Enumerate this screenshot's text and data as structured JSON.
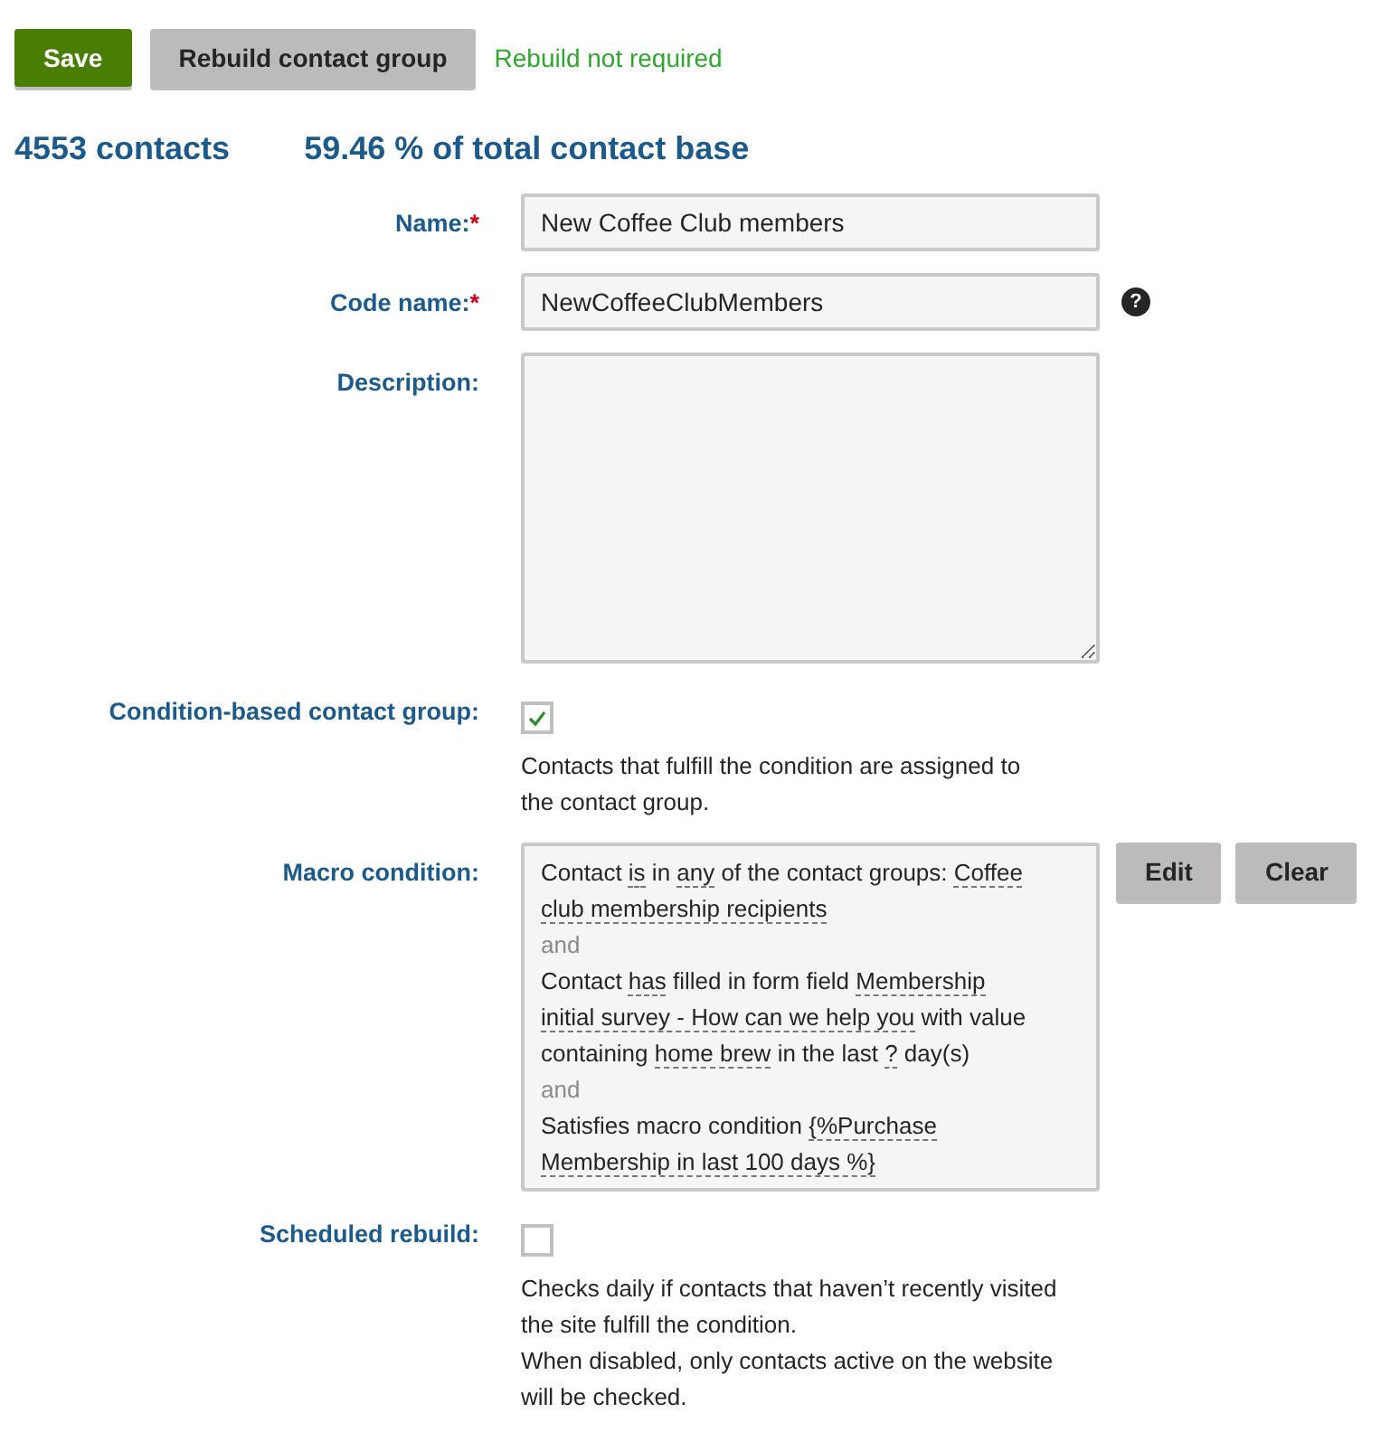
{
  "toolbar": {
    "buttons": [
      {
        "label": "Save",
        "kind": "primary"
      },
      {
        "label": "Rebuild contact group",
        "kind": "secondary"
      }
    ],
    "status": "Rebuild not required"
  },
  "summary": {
    "contacts": "4553 contacts",
    "share": "59.46 % of total contact base"
  },
  "fields": [
    {
      "kind": "text",
      "label": "Name:",
      "required_mark": "*",
      "value": "New Coffee Club members"
    },
    {
      "kind": "text",
      "label": "Code name:",
      "required_mark": "*",
      "value": "NewCoffeeClubMembers",
      "help": "?"
    },
    {
      "kind": "textarea",
      "label": "Description:"
    },
    {
      "kind": "checkbox",
      "label": "Condition-based contact group:",
      "checked": true,
      "notes": [
        "Contacts that fulfill the condition are assigned to",
        "the contact group."
      ]
    },
    {
      "kind": "macro",
      "label": "Macro condition:",
      "buttons": [
        "Edit",
        "Clear"
      ],
      "items": [
        {
          "kind": "clause",
          "lines": [
            [
              {
                "text": "Contact ",
                "link": false
              },
              {
                "text": "is",
                "link": true
              },
              {
                "text": " in ",
                "link": false
              },
              {
                "text": "any",
                "link": true
              },
              {
                "text": " of the contact groups: ",
                "link": false
              },
              {
                "text": "Coffee",
                "link": true
              }
            ],
            [
              {
                "text": "club membership recipients",
                "link": true
              }
            ]
          ]
        },
        {
          "kind": "operator",
          "text": "and"
        },
        {
          "kind": "clause",
          "lines": [
            [
              {
                "text": "Contact ",
                "link": false
              },
              {
                "text": "has",
                "link": true
              },
              {
                "text": " filled in form field ",
                "link": false
              },
              {
                "text": "Membership",
                "link": true
              }
            ],
            [
              {
                "text": "initial survey - How can we help you",
                "link": true
              },
              {
                "text": " with value",
                "link": false
              }
            ],
            [
              {
                "text": "containing ",
                "link": false
              },
              {
                "text": "home brew",
                "link": true
              },
              {
                "text": " in the last ",
                "link": false
              },
              {
                "text": "?",
                "link": true
              },
              {
                "text": " day(s)",
                "link": false
              }
            ]
          ]
        },
        {
          "kind": "operator",
          "text": "and"
        },
        {
          "kind": "clause",
          "lines": [
            [
              {
                "text": "Satisfies macro condition ",
                "link": false
              },
              {
                "text": "{%Purchase",
                "link": true
              }
            ],
            [
              {
                "text": "Membership in last 100 days %}",
                "link": true
              }
            ]
          ]
        }
      ]
    },
    {
      "kind": "checkbox",
      "label": "Scheduled rebuild:",
      "checked": false,
      "notes": [
        "Checks daily if contacts that haven’t recently visited",
        "the site fulfill the condition.",
        "When disabled, only contacts active on the website",
        "will be checked."
      ]
    }
  ]
}
